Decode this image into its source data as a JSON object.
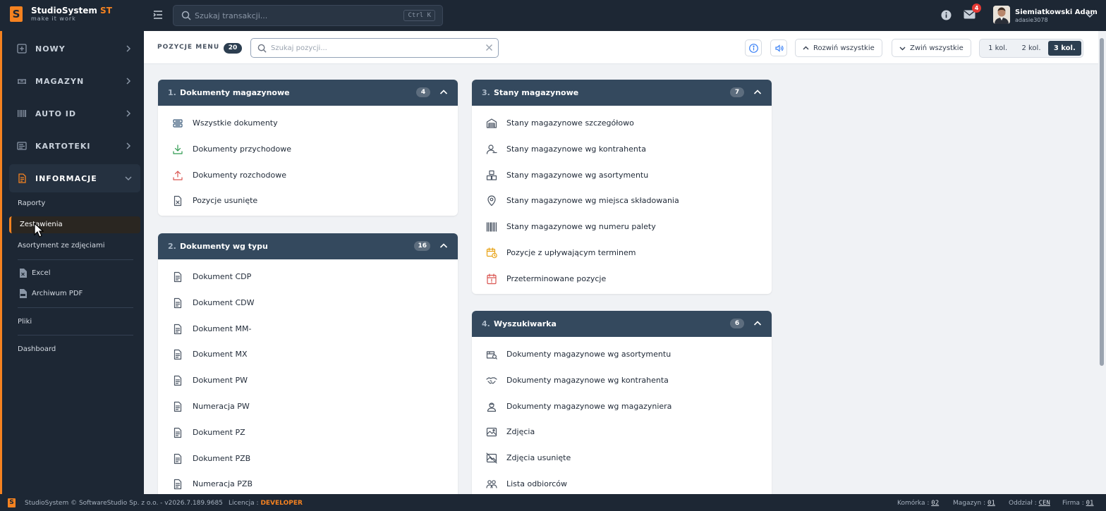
{
  "app": {
    "name": "StudioSystem",
    "name_suffix": "ST",
    "tagline": "make it work"
  },
  "topbar": {
    "search_placeholder": "Szukaj transakcji...",
    "search_shortcut": "Ctrl K",
    "notification_count": "4",
    "user_name": "Siemiatkowski Adam",
    "user_login": "adasie3078"
  },
  "sidebar": {
    "main_items": [
      {
        "label": "NOWY",
        "icon": "plus-square-icon"
      },
      {
        "label": "MAGAZYN",
        "icon": "warehouse-icon"
      },
      {
        "label": "AUTO ID",
        "icon": "barcode-icon"
      },
      {
        "label": "KARTOTEKI",
        "icon": "card-index-icon"
      },
      {
        "label": "INFORMACJE",
        "icon": "document-icon",
        "expanded": true
      }
    ],
    "sub_items": [
      "Raporty",
      "Zestawienia",
      "Asortyment ze zdjęciami"
    ],
    "current_sub": "Zestawienia",
    "export_items": [
      {
        "label": "Excel",
        "icon": "excel-file-icon"
      },
      {
        "label": "Archiwum PDF",
        "icon": "pdf-archive-icon"
      }
    ],
    "extra_items": [
      "Pliki",
      "Dashboard"
    ]
  },
  "toolbar": {
    "title": "POZYCJE MENU",
    "count": "20",
    "search_placeholder": "Szukaj pozycji...",
    "expand_all": "Rozwiń wszystkie",
    "collapse_all": "Zwiń wszystkie",
    "columns": [
      "1 kol.",
      "2 kol.",
      "3 kol."
    ],
    "active_column": "3 kol."
  },
  "cards": [
    {
      "num": "1.",
      "title": "Dokumenty magazynowe",
      "count": "4",
      "items": [
        {
          "label": "Wszystkie dokumenty",
          "icon": "inbox-stack-icon",
          "color": "#3b5b7a"
        },
        {
          "label": "Dokumenty przychodowe",
          "icon": "download-icon",
          "color": "#2e9a4f"
        },
        {
          "label": "Dokumenty rozchodowe",
          "icon": "upload-icon",
          "color": "#d9534f"
        },
        {
          "label": "Pozycje usunięte",
          "icon": "file-x-icon",
          "color": "#4b5563"
        }
      ]
    },
    {
      "num": "2.",
      "title": "Dokumenty wg typu",
      "count": "16",
      "items": [
        {
          "label": "Dokument CDP",
          "icon": "file-text-icon",
          "color": "#4b5563"
        },
        {
          "label": "Dokument CDW",
          "icon": "file-text-icon",
          "color": "#4b5563"
        },
        {
          "label": "Dokument MM-",
          "icon": "file-text-icon",
          "color": "#4b5563"
        },
        {
          "label": "Dokument MX",
          "icon": "file-text-icon",
          "color": "#4b5563"
        },
        {
          "label": "Dokument PW",
          "icon": "file-text-icon",
          "color": "#4b5563"
        },
        {
          "label": "Numeracja PW",
          "icon": "file-text-icon",
          "color": "#4b5563"
        },
        {
          "label": "Dokument PZ",
          "icon": "file-text-icon",
          "color": "#4b5563"
        },
        {
          "label": "Dokument PZB",
          "icon": "file-text-icon",
          "color": "#4b5563"
        },
        {
          "label": "Numeracja PZB",
          "icon": "file-text-icon",
          "color": "#4b5563"
        }
      ]
    },
    {
      "num": "3.",
      "title": "Stany magazynowe",
      "count": "7",
      "items": [
        {
          "label": "Stany magazynowe szczegółowo",
          "icon": "warehouse-detail-icon",
          "color": "#4b5563"
        },
        {
          "label": "Stany magazynowe wg kontrahenta",
          "icon": "user-icon",
          "color": "#4b5563"
        },
        {
          "label": "Stany magazynowe wg asortymentu",
          "icon": "boxes-icon",
          "color": "#4b5563"
        },
        {
          "label": "Stany magazynowe wg miejsca składowania",
          "icon": "map-pin-icon",
          "color": "#4b5563"
        },
        {
          "label": "Stany magazynowe wg numeru palety",
          "icon": "barcode-icon",
          "color": "#4b5563"
        },
        {
          "label": "Pozycje z upływającym terminem",
          "icon": "calendar-clock-icon",
          "color": "#e8a317"
        },
        {
          "label": "Przeterminowane pozycje",
          "icon": "calendar-alert-icon",
          "color": "#d9534f"
        }
      ]
    },
    {
      "num": "4.",
      "title": "Wyszukiwarka",
      "count": "6",
      "items": [
        {
          "label": "Dokumenty magazynowe wg asortymentu",
          "icon": "box-search-icon",
          "color": "#4b5563"
        },
        {
          "label": "Dokumenty magazynowe wg kontrahenta",
          "icon": "handshake-icon",
          "color": "#4b5563"
        },
        {
          "label": "Dokumenty magazynowe wg magazyniera",
          "icon": "worker-icon",
          "color": "#4b5563"
        },
        {
          "label": "Zdjęcia",
          "icon": "image-icon",
          "color": "#4b5563"
        },
        {
          "label": "Zdjęcia usunięte",
          "icon": "image-off-icon",
          "color": "#4b5563"
        },
        {
          "label": "Lista odbiorców",
          "icon": "users-icon",
          "color": "#4b5563"
        }
      ]
    }
  ],
  "footer": {
    "copyright": "StudioSystem © SoftwareStudio Sp. z o.o. - v2026.7.189.9685",
    "license_label": "Licencja :",
    "license_value": "DEVELOPER",
    "cell_label": "Komórka :",
    "cell_value": "02",
    "warehouse_label": "Magazyn :",
    "warehouse_value": "01",
    "branch_label": "Oddział :",
    "branch_value": "CEN",
    "company_label": "Firma :",
    "company_value": "01"
  },
  "colors": {
    "accent": "#f58220",
    "sidebar_bg": "#1d2734",
    "card_header": "#34495e"
  }
}
